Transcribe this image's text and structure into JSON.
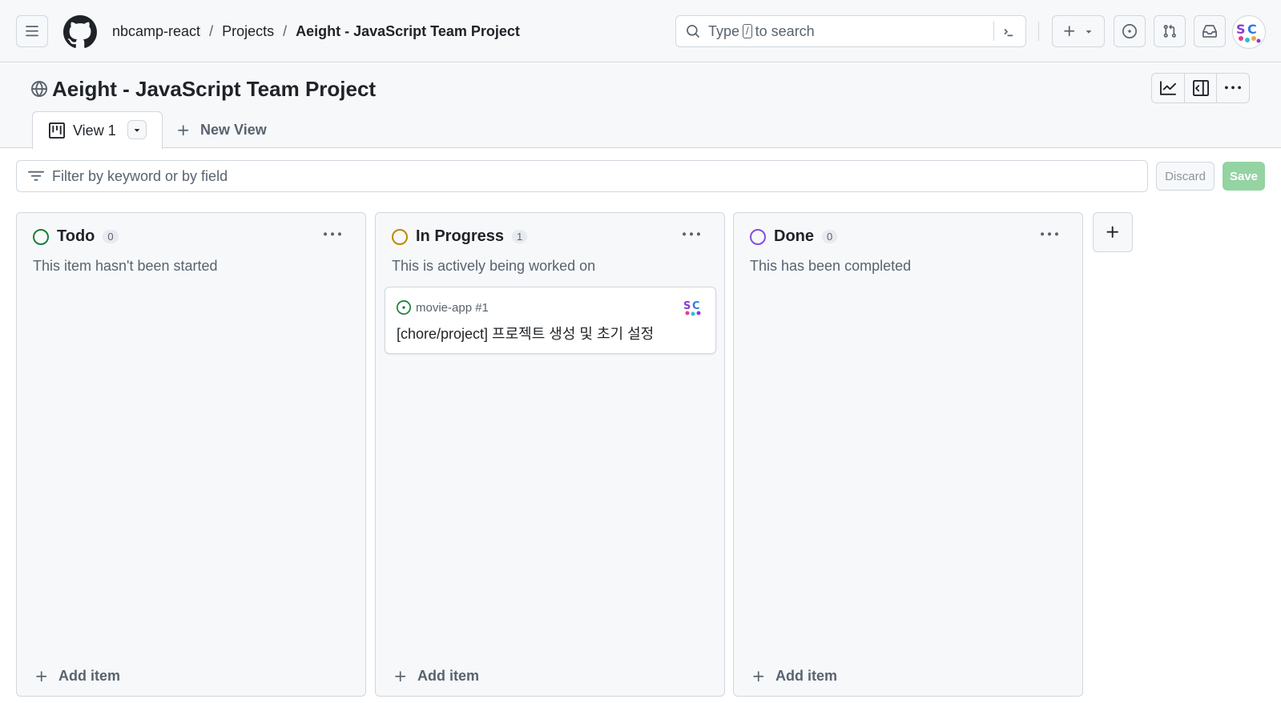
{
  "header": {
    "breadcrumb": {
      "org": "nbcamp-react",
      "section": "Projects",
      "current": "Aeight - JavaScript Team Project",
      "separator": "/"
    },
    "search": {
      "prefix": "Type",
      "key": "/",
      "suffix": "to search"
    },
    "icons": [
      "hamburger-menu-icon",
      "github-logo-icon",
      "search-icon",
      "command-palette-icon",
      "plus-icon",
      "triangle-down-icon",
      "issue-opened-icon",
      "git-pull-request-icon",
      "inbox-icon"
    ]
  },
  "project": {
    "title": "Aeight - JavaScript Team Project",
    "tabs": [
      {
        "label": "View 1",
        "active": true
      }
    ],
    "new_view_label": "New View"
  },
  "filter": {
    "placeholder": "Filter by keyword or by field",
    "discard_label": "Discard",
    "save_label": "Save"
  },
  "board": {
    "columns": [
      {
        "name": "Todo",
        "count": "0",
        "description": "This item hasn't been started",
        "color": "#1a7f37",
        "add_label": "Add item",
        "cards": []
      },
      {
        "name": "In Progress",
        "count": "1",
        "description": "This is actively being worked on",
        "color": "#bf8700",
        "add_label": "Add item",
        "cards": [
          {
            "repo": "movie-app #1",
            "title": "[chore/project] 프로젝트 생성 및 초기 설정",
            "status_color": "#1a7f37"
          }
        ]
      },
      {
        "name": "Done",
        "count": "0",
        "description": "This has been completed",
        "color": "#8250df",
        "add_label": "Add item",
        "cards": []
      }
    ]
  },
  "colors": {
    "accent_green": "#1a7f37",
    "save_disabled": "#94d3a2",
    "border": "#d0d7de",
    "canvas_subtle": "#f6f8fa"
  }
}
